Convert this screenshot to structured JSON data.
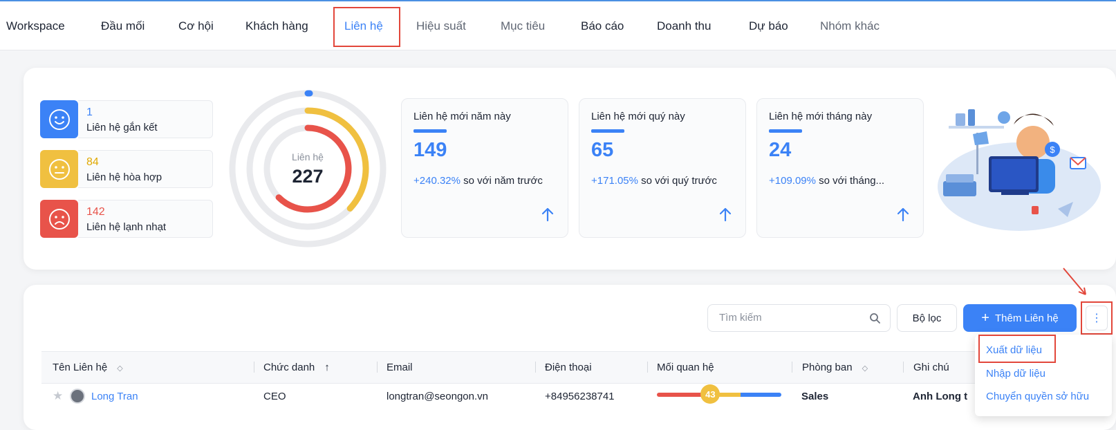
{
  "nav": {
    "items": [
      "Workspace",
      "Đầu mối",
      "Cơ hội",
      "Khách hàng",
      "Liên hệ",
      "Hiệu suất",
      "Mục tiêu",
      "Báo cáo",
      "Doanh thu",
      "Dự báo",
      "Nhóm khác"
    ],
    "active_index": 4
  },
  "stats": [
    {
      "value": "1",
      "label": "Liên hệ gắn kết",
      "color": "#3b82f6",
      "icon": "smile-face-icon"
    },
    {
      "value": "84",
      "label": "Liên hệ hòa hợp",
      "color": "#f0c040",
      "icon": "neutral-face-icon"
    },
    {
      "value": "142",
      "label": "Liên hệ lạnh nhạt",
      "color": "#e8534a",
      "icon": "sad-face-icon"
    }
  ],
  "donut": {
    "label": "Liên hệ",
    "total": "227",
    "rings": [
      1,
      84,
      142
    ]
  },
  "kpis": [
    {
      "title": "Liên hệ mới năm này",
      "value": "149",
      "pct": "+240.32%",
      "text": " so với năm trước"
    },
    {
      "title": "Liên hệ mới quý này",
      "value": "65",
      "pct": "+171.05%",
      "text": " so với quý trước"
    },
    {
      "title": "Liên hệ mới tháng này",
      "value": "24",
      "pct": "+109.09%",
      "text": " so với tháng..."
    }
  ],
  "toolbar": {
    "search_placeholder": "Tìm kiếm",
    "filter_label": "Bộ lọc",
    "add_label": "Thêm Liên hệ",
    "more_label": "⋮"
  },
  "menu": [
    "Xuất dữ liệu",
    "Nhập dữ liệu",
    "Chuyển quyền sở hữu"
  ],
  "table": {
    "columns": [
      "Tên Liên hệ",
      "Chức danh",
      "Email",
      "Điện thoại",
      "Mối quan hệ",
      "Phòng ban",
      "Ghi chú"
    ],
    "rows": [
      {
        "name": "Long Tran",
        "title": "CEO",
        "email": "longtran@seongon.vn",
        "phone": "+84956238741",
        "relation": "43",
        "department": "Sales",
        "note": "Anh Long t"
      }
    ]
  },
  "colors": {
    "accent": "#3b82f6",
    "yellow": "#f0c040",
    "red": "#e8534a",
    "highlight": "#e2463a"
  }
}
